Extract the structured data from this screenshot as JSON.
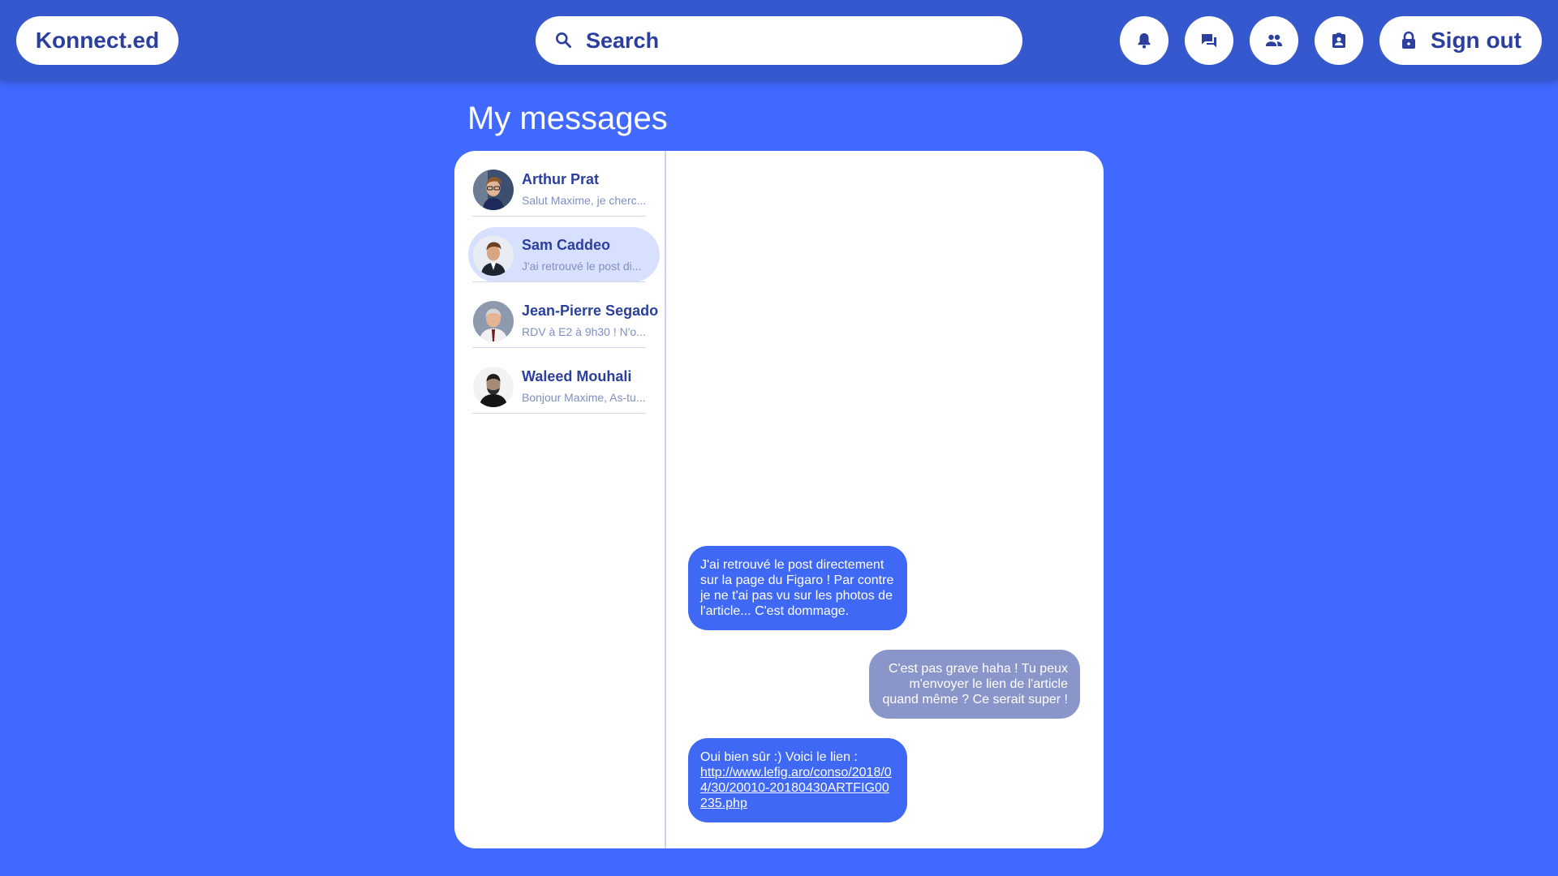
{
  "header": {
    "logo": "Konnect.ed",
    "search_placeholder": "Search",
    "icons": [
      "bell-icon",
      "chat-icon",
      "people-icon",
      "contacts-icon",
      "lock-icon"
    ],
    "signout_label": "Sign out"
  },
  "page": {
    "title": "My messages"
  },
  "conversations": [
    {
      "name": "Arthur Prat",
      "preview": "Salut Maxime, je cherc...",
      "active": false
    },
    {
      "name": "Sam Caddeo",
      "preview": "J'ai retrouvé le post di...",
      "active": true
    },
    {
      "name": "Jean-Pierre Segado",
      "preview": "RDV à E2 à 9h30 ! N'o...",
      "active": false
    },
    {
      "name": "Waleed Mouhali",
      "preview": "Bonjour Maxime, As-tu...",
      "active": false
    }
  ],
  "messages": [
    {
      "direction": "in",
      "text": "J'ai retrouvé le post directement sur la page du Figaro ! Par contre je ne t'ai pas vu sur les photos de l'article... C'est dommage."
    },
    {
      "direction": "out",
      "text": "C'est pas grave haha ! Tu peux m'envoyer le lien de l'article quand même ? Ce serait super !"
    },
    {
      "direction": "in",
      "text": "Oui bien sûr :) Voici le lien :",
      "link": "http://www.lefig.aro/conso/2018/04/30/20010-20180430ARTFIG00235.php"
    }
  ],
  "colors": {
    "background": "#4169ff",
    "topbar": "#3558cf",
    "incoming_bubble": "#3f68f5",
    "outgoing_bubble": "#8a96c9",
    "active_conversation": "#d7e0fd"
  }
}
